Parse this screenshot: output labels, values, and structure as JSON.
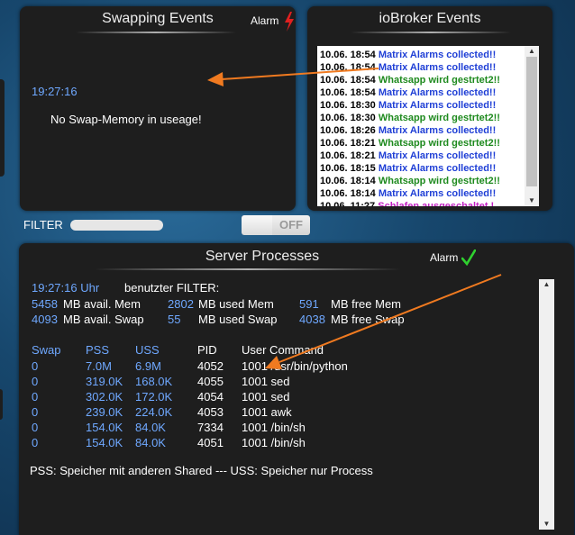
{
  "swapping": {
    "title": "Swapping Events",
    "alarm_label": "Alarm",
    "time": "19:27:16",
    "message": "No Swap-Memory in useage!"
  },
  "events": {
    "title": "ioBroker Events",
    "items": [
      {
        "date": "10.06. 18:54",
        "text": "Matrix Alarms collected!!",
        "color": "#1f3fd6"
      },
      {
        "date": "10.06. 18:54",
        "text": "Matrix Alarms collected!!",
        "color": "#1f3fd6"
      },
      {
        "date": "10.06. 18:54",
        "text": "Whatsapp wird gestrtet2!!",
        "color": "#1e8a1e"
      },
      {
        "date": "10.06. 18:54",
        "text": "Matrix Alarms collected!!",
        "color": "#1f3fd6"
      },
      {
        "date": "10.06. 18:30",
        "text": "Matrix Alarms collected!!",
        "color": "#1f3fd6"
      },
      {
        "date": "10.06. 18:30",
        "text": "Whatsapp wird gestrtet2!!",
        "color": "#1e8a1e"
      },
      {
        "date": "10.06. 18:26",
        "text": "Matrix Alarms collected!!",
        "color": "#1f3fd6"
      },
      {
        "date": "10.06. 18:21",
        "text": "Whatsapp wird gestrtet2!!",
        "color": "#1e8a1e"
      },
      {
        "date": "10.06. 18:21",
        "text": "Matrix Alarms collected!!",
        "color": "#1f3fd6"
      },
      {
        "date": "10.06. 18:15",
        "text": "Matrix Alarms collected!!",
        "color": "#1f3fd6"
      },
      {
        "date": "10.06. 18:14",
        "text": "Whatsapp wird gestrtet2!!",
        "color": "#1e8a1e"
      },
      {
        "date": "10.06. 18:14",
        "text": "Matrix Alarms collected!!",
        "color": "#1f3fd6"
      },
      {
        "date": "10.06. 11:27",
        "text": "Schlafen ausgeschaltet !",
        "color": "#c21fc2"
      }
    ]
  },
  "filter": {
    "label": "FILTER",
    "value": "",
    "toggle_label": "OFF"
  },
  "processes": {
    "title": "Server Processes",
    "alarm_label": "Alarm",
    "time": "19:27:16 Uhr",
    "user_filter": "benutzter FILTER:",
    "mem": {
      "avail_mem_value": "5458",
      "avail_mem_label": "MB avail. Mem",
      "used_mem_value": "2802",
      "used_mem_label": "MB used Mem",
      "free_mem_value": "591",
      "free_mem_label": "MB free Mem",
      "avail_swap_value": "4093",
      "avail_swap_label": "MB avail. Swap",
      "used_swap_value": "55",
      "used_swap_label": "MB used Swap",
      "free_swap_value": "4038",
      "free_swap_label": "MB free Swap"
    },
    "columns": {
      "swap": "Swap",
      "pss": "PSS",
      "uss": "USS",
      "pid": "PID",
      "user_command": "User Command"
    },
    "rows": [
      {
        "swap": "0",
        "pss": "7.0M",
        "uss": "6.9M",
        "pid": "4052",
        "cmd": "1001 /usr/bin/python"
      },
      {
        "swap": "0",
        "pss": "319.0K",
        "uss": "168.0K",
        "pid": "4055",
        "cmd": "1001 sed"
      },
      {
        "swap": "0",
        "pss": "302.0K",
        "uss": "172.0K",
        "pid": "4054",
        "cmd": "1001 sed"
      },
      {
        "swap": "0",
        "pss": "239.0K",
        "uss": "224.0K",
        "pid": "4053",
        "cmd": "1001 awk"
      },
      {
        "swap": "0",
        "pss": "154.0K",
        "uss": "84.0K",
        "pid": "7334",
        "cmd": "1001 /bin/sh"
      },
      {
        "swap": "0",
        "pss": "154.0K",
        "uss": "84.0K",
        "pid": "4051",
        "cmd": "1001 /bin/sh"
      }
    ],
    "footer": "PSS: Speicher mit anderen Shared --- USS: Speicher nur Process"
  },
  "colors": {
    "accent_blue": "#6fa8ff",
    "alarm_red": "#e02020",
    "alarm_green": "#2fd12f",
    "annotation_arrow": "#f07a20"
  },
  "icons": {
    "swap_alarm": "lightning-icon",
    "proc_alarm": "checkmark-icon"
  }
}
